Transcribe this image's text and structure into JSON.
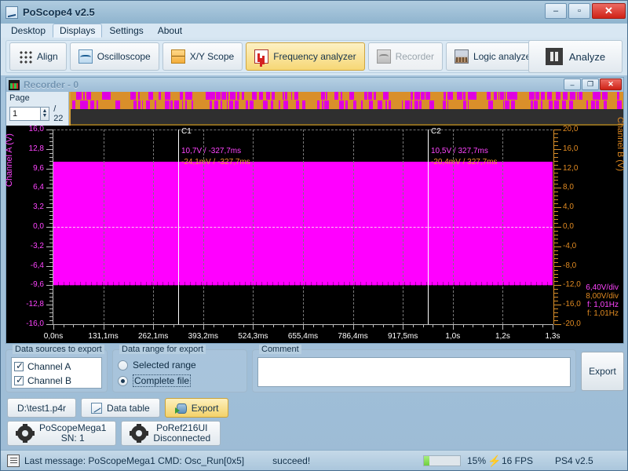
{
  "window": {
    "title": "PoScope4 v2.5",
    "icon": "app-icon",
    "minimize": "–",
    "maximize": "▫",
    "close": "✕"
  },
  "menu": {
    "items": [
      {
        "label": "Desktop",
        "active": false
      },
      {
        "label": "Displays",
        "active": true
      },
      {
        "label": "Settings",
        "active": false
      },
      {
        "label": "About",
        "active": false
      }
    ]
  },
  "toolbar": {
    "buttons": [
      {
        "label": "Align",
        "icon": "align-grid-icon",
        "state": "normal"
      },
      {
        "label": "Oscilloscope",
        "icon": "oscilloscope-icon",
        "state": "normal"
      },
      {
        "label": "X/Y Scope",
        "icon": "xy-scope-icon",
        "state": "normal"
      },
      {
        "label": "Frequency analyzer",
        "icon": "frequency-analyzer-icon",
        "state": "selected"
      },
      {
        "label": "Recorder",
        "icon": "recorder-icon",
        "state": "disabled"
      },
      {
        "label": "Logic analyzer",
        "icon": "logic-analyzer-icon",
        "state": "normal"
      }
    ],
    "analyze": {
      "label": "Analyze",
      "icon": "pause-icon"
    }
  },
  "recorder": {
    "title": "Recorder - 0",
    "icon": "recorder-window-icon",
    "minimize": "–",
    "restore": "❐",
    "close": "✕",
    "page": {
      "label": "Page",
      "value": "1",
      "total": "/ 22",
      "spin_up": "▲",
      "spin_down": "▼"
    }
  },
  "chart_data": {
    "type": "area",
    "title": "Recorder - 0",
    "xlabel": "",
    "ylabel": "Channel A (V)",
    "y2label": "Channel B (V)",
    "grid": true,
    "legend": "none",
    "yticks_left": [
      "16,0",
      "12,8",
      "9,6",
      "6,4",
      "3,2",
      "0,0",
      "-3,2",
      "-6,4",
      "-9,6",
      "-12,8",
      "-16,0"
    ],
    "ylim_left": [
      -16.0,
      16.0
    ],
    "yticks_right": [
      "20,0",
      "16,0",
      "12,0",
      "8,0",
      "4,0",
      "0,0",
      "-4,0",
      "-8,0",
      "-12,0",
      "-16,0",
      "-20,0"
    ],
    "ylim_right": [
      -20.0,
      20.0
    ],
    "xticks": [
      "0,0ns",
      "131,1ms",
      "262,1ms",
      "393,2ms",
      "524,3ms",
      "655,4ms",
      "786,4ms",
      "917,5ms",
      "1,0s",
      "1,2s",
      "1,3s"
    ],
    "xlim_ms": [
      0,
      1310.7
    ],
    "series": [
      {
        "name": "Channel A",
        "color": "#ff00ff",
        "description": "Filled oscillating band, envelope approximately +10,7 V to -9,6 V",
        "envelope_max_v": 10.7,
        "envelope_min_v": -9.6,
        "volts_per_div": "6,40V/div",
        "frequency": "f: 1,01Hz"
      },
      {
        "name": "Channel B",
        "color": "#e08a22",
        "description": "Near-zero flat trace overlapped by channel A band",
        "volts_per_div": "8,00V/div",
        "frequency": "f: 1,01Hz"
      }
    ],
    "cursors": [
      {
        "name": "C1",
        "x_ms": -327.7,
        "channel_a_text": "10,7V / -327,7ms",
        "channel_b_text": "-24,1mV / -327,7ms"
      },
      {
        "name": "C2",
        "x_ms": 327.7,
        "channel_a_text": "10,5V / 327,7ms",
        "channel_b_text": "-20,4mV / 327,7ms"
      }
    ],
    "info_lines": [
      {
        "text": "6,40V/div",
        "color": "#ff44ff"
      },
      {
        "text": "8,00V/div",
        "color": "#e08a22"
      },
      {
        "text": "f: 1,01Hz",
        "color": "#ff44ff"
      },
      {
        "text": "f: 1,01Hz",
        "color": "#e08a22"
      }
    ]
  },
  "export": {
    "sources": {
      "title": "Data sources to export",
      "items": [
        {
          "label": "Channel A",
          "checked": true
        },
        {
          "label": "Channel B",
          "checked": true
        }
      ]
    },
    "range": {
      "title": "Data range for export",
      "options": [
        {
          "label": "Selected range",
          "selected": false
        },
        {
          "label": "Complete file",
          "selected": true
        }
      ]
    },
    "comment": {
      "title": "Comment",
      "value": "",
      "placeholder": ""
    },
    "export_button": "Export"
  },
  "bottom": {
    "file_button": "D:\\test1.p4r",
    "data_table_button": "Data table",
    "data_table_icon": "table-icon",
    "export_button": "Export",
    "export_icon": "database-export-icon",
    "devices": [
      {
        "name": "PoScopeMega1",
        "status": "SN: 1",
        "icon": "gear-icon"
      },
      {
        "name": "PoRef216UI",
        "status": "Disconnected",
        "icon": "gear-icon"
      }
    ]
  },
  "status": {
    "icon": "message-icon",
    "message": "Last message: PoScopeMega1 CMD: Osc_Run[0x5]",
    "result": "succeed!",
    "progress_percent": 15,
    "progress_label": "15%",
    "fps_icon": "lightning-icon",
    "fps": "16 FPS",
    "version": "PS4 v2.5"
  }
}
